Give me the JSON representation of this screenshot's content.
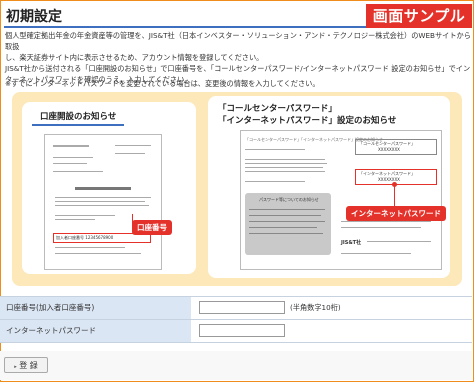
{
  "sample_label": "画面サンプル",
  "page_title": "初期設定",
  "intro": {
    "line1": "個人型確定拠出年金の年金資産等の管理を、JIS&T社（日本インベスター・ソリューション・アンド・テクノロジー株式会社）のWEBサイトから取扱",
    "line2": "し、楽天証券サイト内に表示させるため、アカウント情報を登録してください。",
    "line3": "JIS&T社から送付される「口座開設のお知らせ」で口座番号を、「コールセンターパスワード/インターネットパスワード 設定のお知らせ」でイン",
    "line4": "ターネットパスワードを確認のうえ、入力してください。",
    "note": "※すでにインターネットパスワードを変更されている場合は、変更後の情報を入力してください。"
  },
  "panel": {
    "left_card_title": "口座開設のお知らせ",
    "left_red_label": "口座番号",
    "left_doc_number_text": "加入者口座番号 12345678900",
    "right_card_title_line1": "「コールセンターパスワード」",
    "right_card_title_line2": "「インターネットパスワード」設定のお知らせ",
    "right_doc_heading": "「コールセンターパスワード」「インターネットパスワード」設定のお知らせ",
    "right_box1_label": "「コールセンターパスワード」",
    "right_box1_value": "XXXXXXXX",
    "right_box2_label": "「インターネットパスワード」",
    "right_box2_value": "XXXXXXXX",
    "right_red_label": "インターネットパスワード",
    "right_gray_box_title": "パスワード等についてのお知らせ",
    "right_logo_text": "JIS&T社"
  },
  "form": {
    "account_label": "口座番号(加入者口座番号)",
    "account_value": "",
    "account_hint": "(半角数字10桁)",
    "password_label": "インターネットパスワード",
    "password_value": ""
  },
  "submit_label": "登 録"
}
